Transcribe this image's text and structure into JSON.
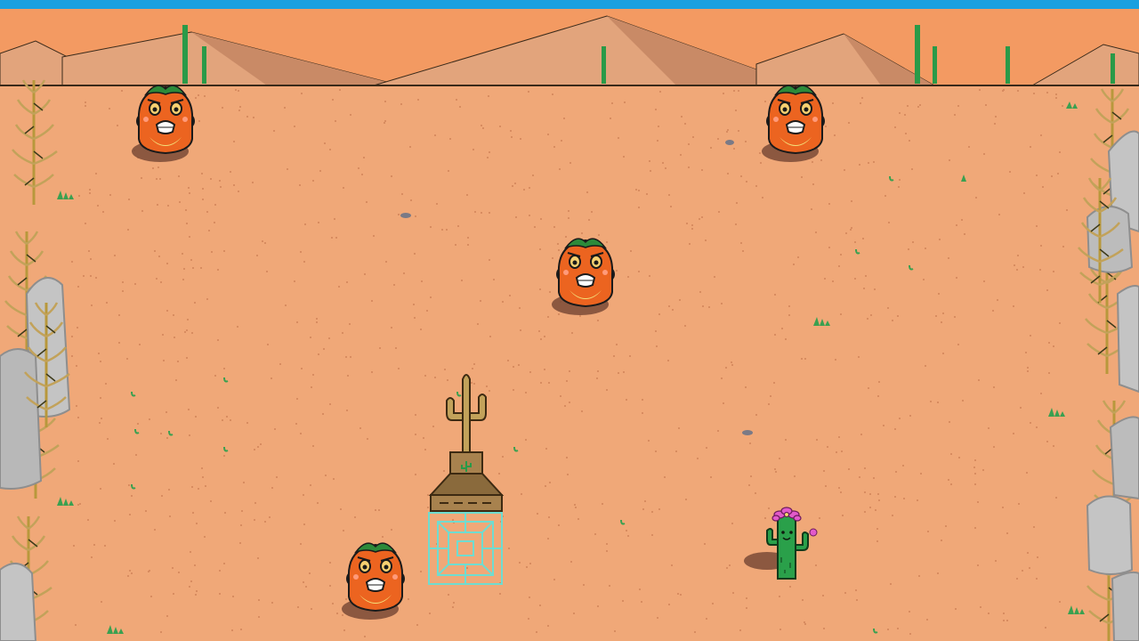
{
  "game": {
    "colors": {
      "sky_strip": "#1aa0e0",
      "sky": "#f39a62",
      "dune": "#e2a47c",
      "dune_shadow": "#c98a66",
      "sand": "#f0a878",
      "shadow": "#7a4a36",
      "rock": "#c4c4c4",
      "rock_dark": "#8e8e8e",
      "cactus_green": "#2aa04a",
      "flower_pink": "#e25aca",
      "enemy_orange": "#ec6420",
      "enemy_belly": "#f3de78",
      "enemy_leaf": "#2c8a3a",
      "dead_cactus": "#c2a25a",
      "post_wood": "#a8824e",
      "tile_cyan": "#6fdcd0"
    },
    "entities": {
      "enemies": [
        {
          "name": "pumpkin-enemy",
          "expression": "scared"
        },
        {
          "name": "pumpkin-enemy",
          "expression": "scared"
        },
        {
          "name": "pumpkin-enemy",
          "expression": "scared"
        },
        {
          "name": "pumpkin-enemy",
          "expression": "scared"
        }
      ],
      "player": {
        "name": "flower-cactus-player"
      },
      "object": {
        "name": "cactus-totem-pedestal"
      },
      "target_tile": {
        "name": "cyan-pattern-tile"
      }
    }
  }
}
